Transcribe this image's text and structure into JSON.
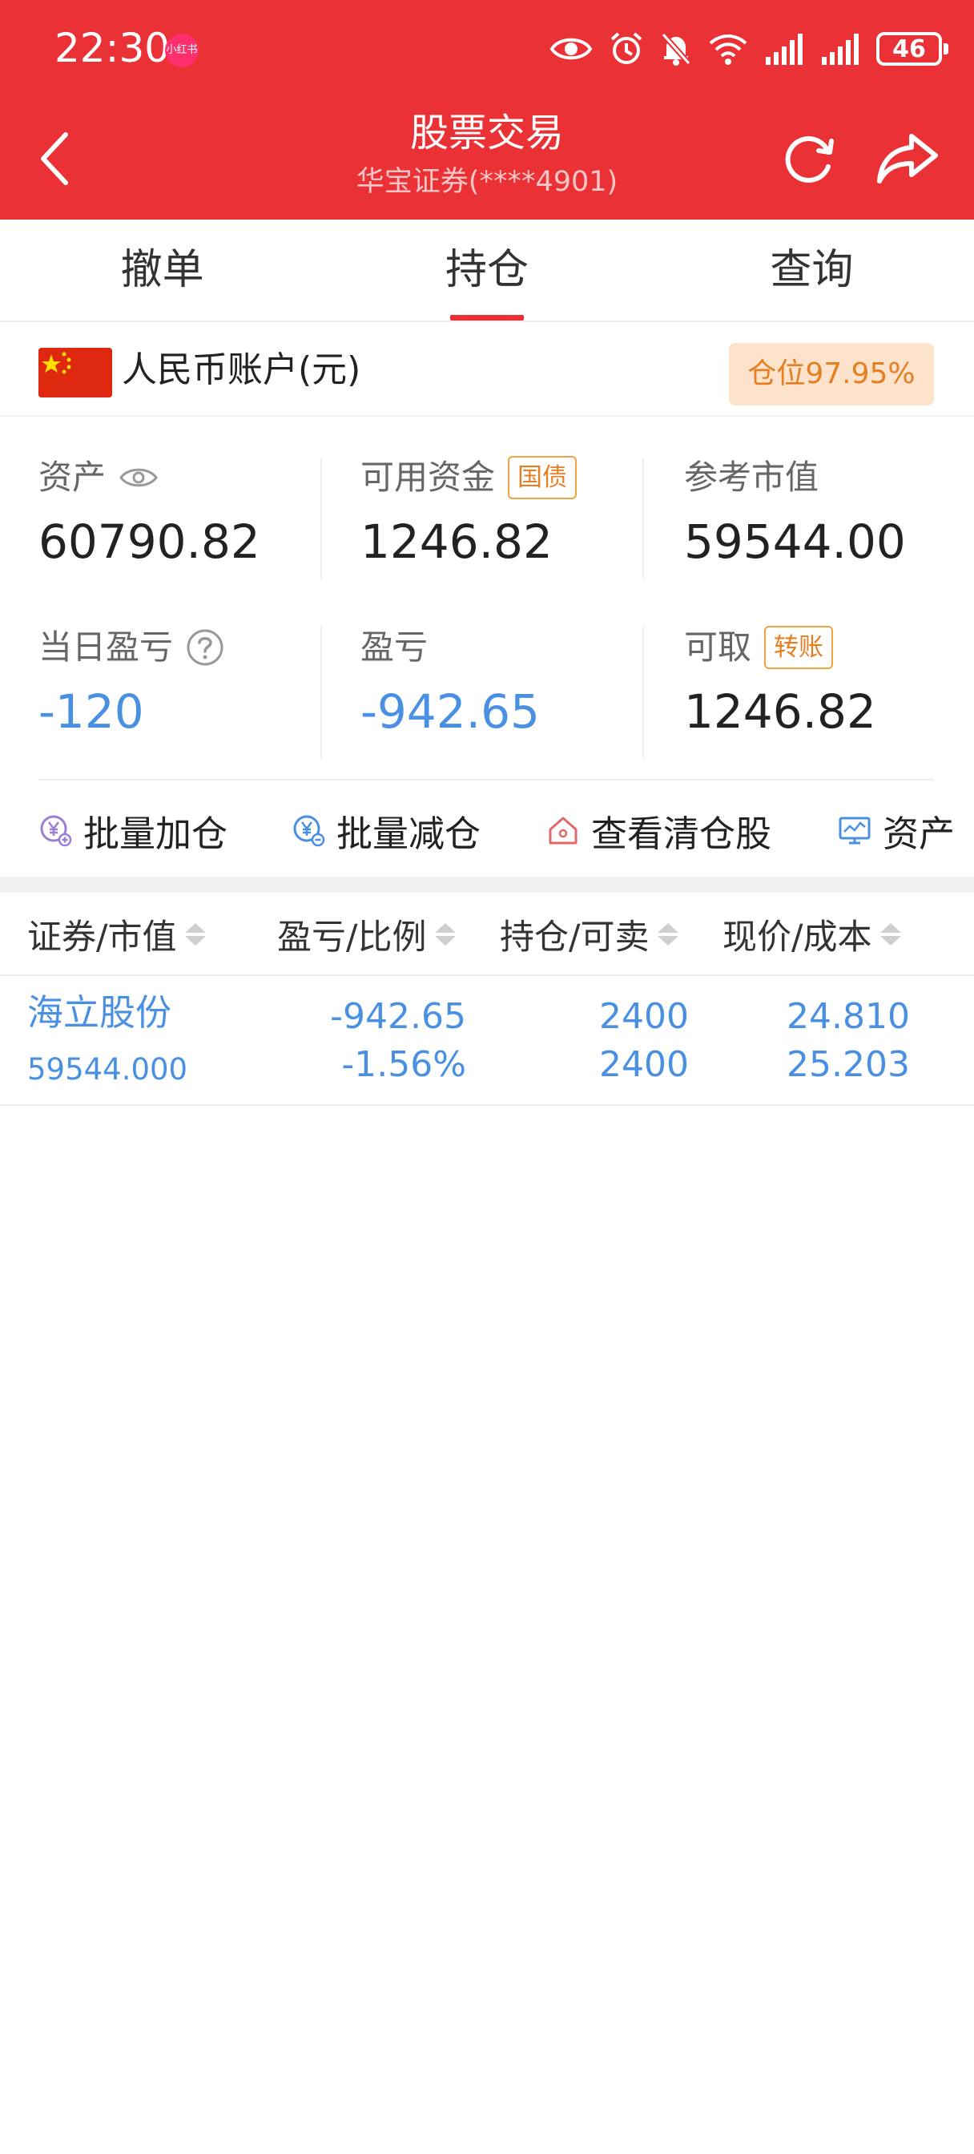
{
  "status_bar": {
    "time": "22:30",
    "notification_badge": "小红书",
    "battery": "46"
  },
  "header": {
    "title": "股票交易",
    "subtitle": "华宝证券(****4901)"
  },
  "tabs": [
    {
      "label": "撤单",
      "active": false
    },
    {
      "label": "持仓",
      "active": true
    },
    {
      "label": "查询",
      "active": false
    }
  ],
  "account": {
    "label": "人民币账户(元)",
    "position_ratio": "仓位97.95%"
  },
  "stats": {
    "assets": {
      "label": "资产",
      "value": "60790.82"
    },
    "available": {
      "label": "可用资金",
      "tag": "国债",
      "value": "1246.82"
    },
    "market_value": {
      "label": "参考市值",
      "value": "59544.00"
    },
    "daily_pnl": {
      "label": "当日盈亏",
      "value": "-120"
    },
    "pnl": {
      "label": "盈亏",
      "value": "-942.65"
    },
    "withdrawable": {
      "label": "可取",
      "tag": "转账",
      "value": "1246.82"
    }
  },
  "actions": [
    {
      "label": "批量加仓",
      "icon": "yen-plus-icon"
    },
    {
      "label": "批量减仓",
      "icon": "yen-minus-icon"
    },
    {
      "label": "查看清仓股",
      "icon": "house-icon"
    },
    {
      "label": "资产",
      "icon": "monitor-chart-icon"
    }
  ],
  "table": {
    "columns": [
      "证券/市值",
      "盈亏/比例",
      "持仓/可卖",
      "现价/成本"
    ],
    "rows": [
      {
        "name": "海立股份",
        "market_value": "59544.000",
        "pnl": "-942.65",
        "pnl_ratio": "-1.56%",
        "holding": "2400",
        "sellable": "2400",
        "price": "24.810",
        "cost": "25.203"
      }
    ]
  },
  "colors": {
    "brand_red": "#e93136",
    "loss_blue": "#4a90e2",
    "badge_orange": "#e67e22"
  }
}
